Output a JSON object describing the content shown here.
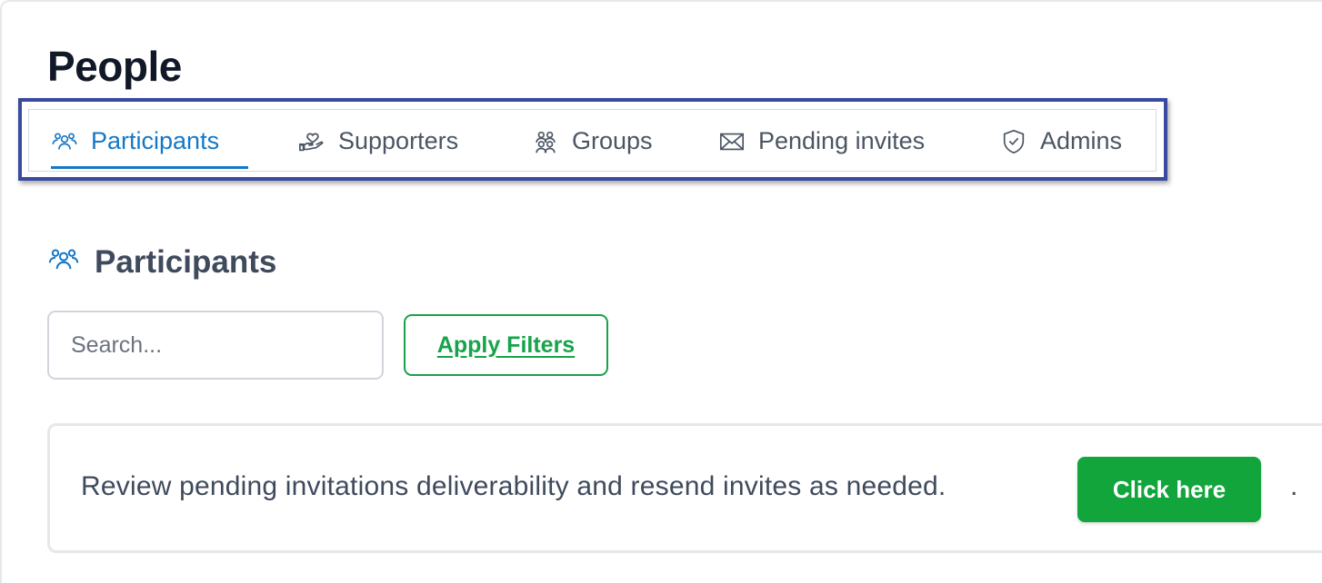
{
  "page": {
    "title": "People"
  },
  "tabs": [
    {
      "label": "Participants",
      "icon": "participants-icon",
      "active": true
    },
    {
      "label": "Supporters",
      "icon": "supporters-icon",
      "active": false
    },
    {
      "label": "Groups",
      "icon": "groups-icon",
      "active": false
    },
    {
      "label": "Pending invites",
      "icon": "envelope-icon",
      "active": false
    },
    {
      "label": "Admins",
      "icon": "shield-icon",
      "active": false
    }
  ],
  "section": {
    "title": "Participants",
    "icon": "participants-icon"
  },
  "search": {
    "placeholder": "Search...",
    "value": ""
  },
  "filters": {
    "apply_label": "Apply Filters"
  },
  "notice": {
    "text": "Review pending invitations deliverability and resend invites as needed.",
    "button_label": "Click here",
    "suffix": "."
  },
  "colors": {
    "accent_blue": "#1478c8",
    "highlight_border": "#3a4a9f",
    "green": "#11a53c"
  }
}
